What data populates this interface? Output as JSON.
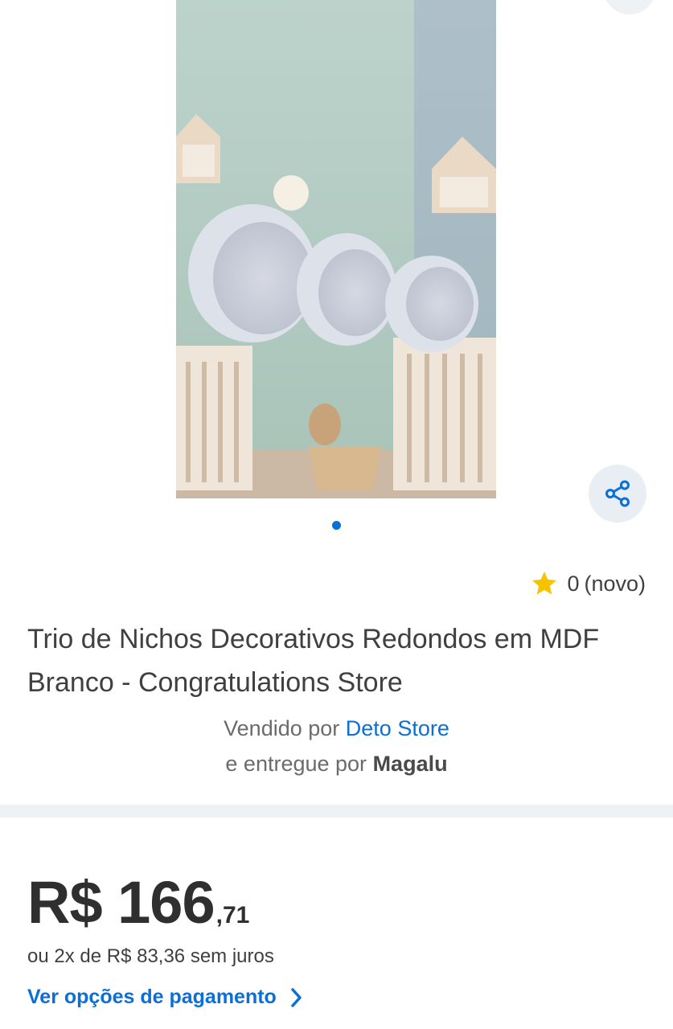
{
  "rating": {
    "value": "0",
    "label": "(novo)"
  },
  "product": {
    "title": "Trio de Nichos Decorativos Redondos em MDF Branco - Congratulations Store"
  },
  "seller": {
    "sold_by_prefix": "Vendido por",
    "sold_by_name": "Deto Store",
    "delivered_by_prefix": "e entregue por",
    "delivered_by_name": "Magalu"
  },
  "price": {
    "main": "R$ 166",
    "cents": ",71",
    "installments": "ou 2x de R$ 83,36 sem juros"
  },
  "payment": {
    "link_label": "Ver opções de pagamento"
  },
  "icons": {
    "share": "share-icon",
    "star": "star-icon",
    "chevron": "chevron-right-icon"
  },
  "colors": {
    "accent": "#0a6fd8",
    "star": "#f5c400",
    "divider": "#eef2f5"
  }
}
